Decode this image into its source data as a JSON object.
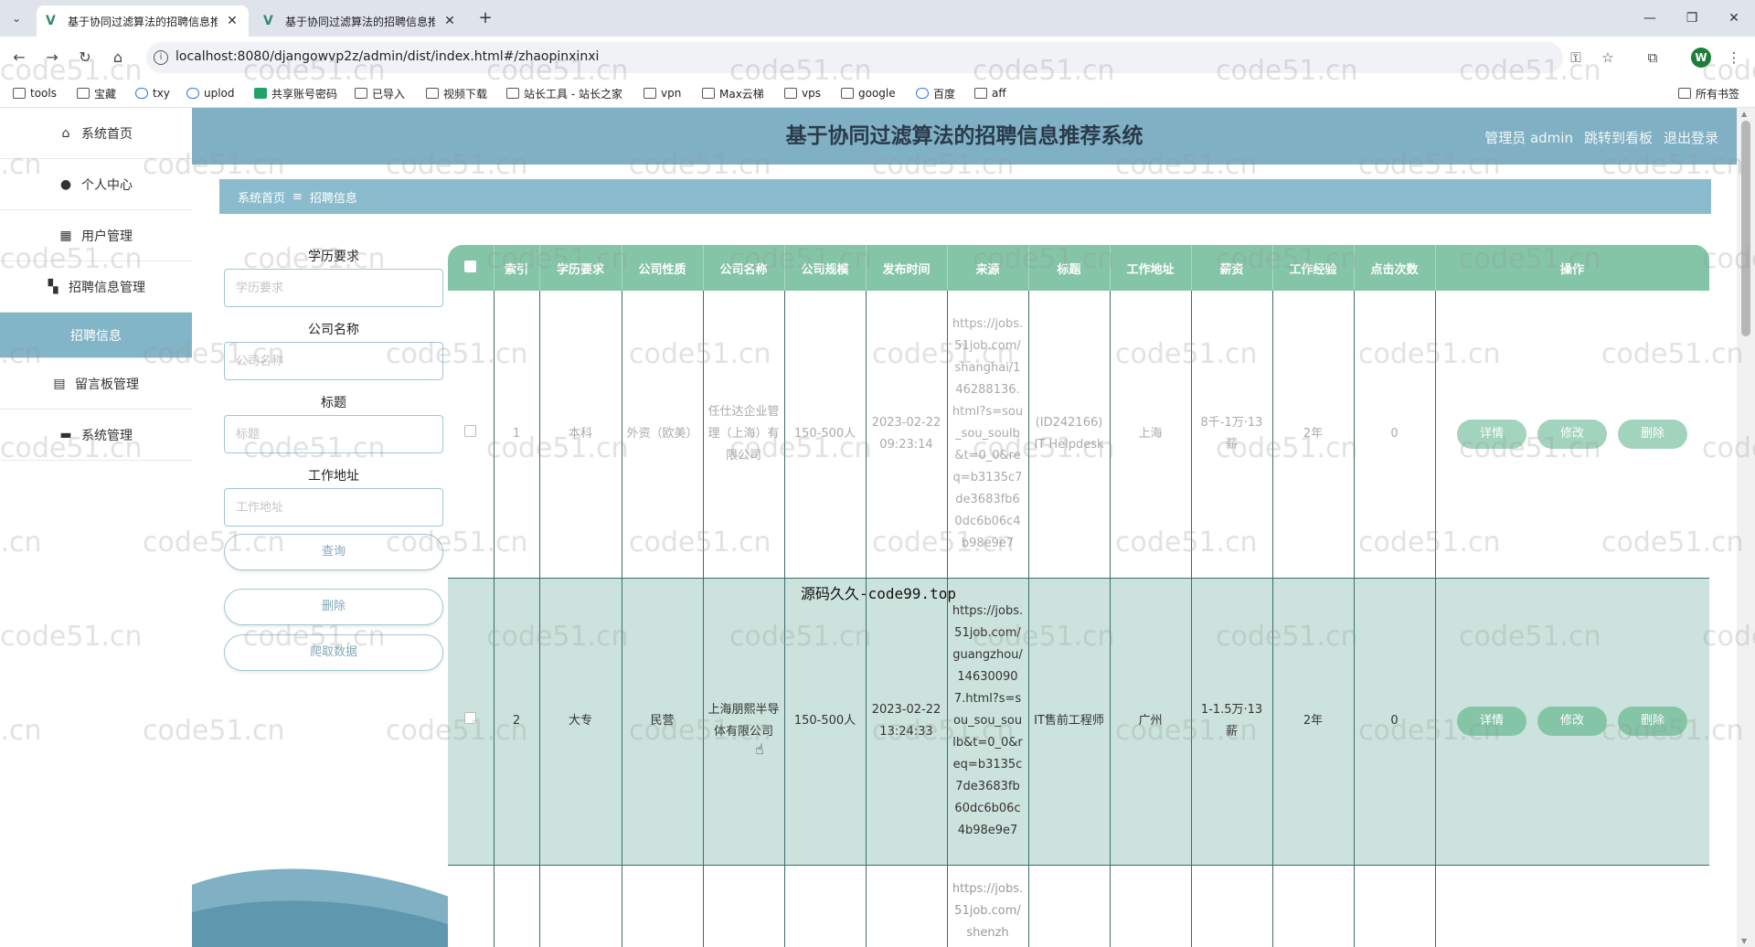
{
  "browser": {
    "tabs": [
      {
        "title": "基于协同过滤算法的招聘信息推",
        "active": true
      },
      {
        "title": "基于协同过滤算法的招聘信息推",
        "active": false
      }
    ],
    "url": "localhost:8080/djangowvp2z/admin/dist/index.html#/zhaopinxinxi",
    "avatar_letter": "W",
    "bookmarks": [
      "tools",
      "宝藏",
      "txy",
      "uplod",
      "共享账号密码",
      "已导入",
      "视频下载",
      "站长工具 - 站长之家",
      "vpn",
      "Max云梯",
      "vps",
      "google",
      "百度",
      "aff"
    ],
    "all_bookmarks": "所有书签"
  },
  "sidebar": {
    "items": [
      {
        "label": "系统首页",
        "icon": "home-icon"
      },
      {
        "label": "个人中心",
        "icon": "user-icon"
      },
      {
        "label": "用户管理",
        "icon": "grid-icon"
      },
      {
        "label": "招聘信息管理",
        "icon": "apps-icon"
      },
      {
        "label": "招聘信息",
        "icon": ""
      },
      {
        "label": "留言板管理",
        "icon": "message-icon"
      },
      {
        "label": "系统管理",
        "icon": "chat-icon"
      }
    ]
  },
  "header": {
    "title": "基于协同过滤算法的招聘信息推荐系统",
    "admin": "管理员 admin",
    "dashboard": "跳转到看板",
    "logout": "退出登录"
  },
  "breadcrumb": {
    "home": "系统首页",
    "sep": "≡",
    "current": "招聘信息"
  },
  "search": {
    "education_label": "学历要求",
    "education_placeholder": "学历要求",
    "company_label": "公司名称",
    "company_placeholder": "公司名称",
    "title_label": "标题",
    "title_placeholder": "标题",
    "address_label": "工作地址",
    "address_placeholder": "工作地址",
    "query_btn": "查询",
    "delete_btn": "删除",
    "crawl_btn": "爬取数据"
  },
  "table": {
    "headers": [
      "索引",
      "学历要求",
      "公司性质",
      "公司名称",
      "公司规模",
      "发布时间",
      "来源",
      "标题",
      "工作地址",
      "薪资",
      "工作经验",
      "点击次数",
      "操作"
    ],
    "rows": [
      {
        "index": "1",
        "education": "本科",
        "nature": "外资（欧美）",
        "company": "任仕达企业管理（上海）有限公司",
        "scale": "150-500人",
        "time": "2023-02-22 09:23:14",
        "source": "https://jobs.51job.com/shanghai/146288136.html?s=sou_sou_soulb&t=0_0&req=b3135c7de3683fb60dc6b06c4b98e9e7",
        "title": "(ID242166) IT Helpdesk",
        "address": "上海",
        "salary": "8千-1万·13薪",
        "experience": "2年",
        "clicks": "0"
      },
      {
        "index": "2",
        "education": "大专",
        "nature": "民营",
        "company": "上海朋熙半导体有限公司",
        "scale": "150-500人",
        "time": "2023-02-22 13:24:33",
        "source": "https://jobs.51job.com/guangzhou/146300907.html?s=sou_sou_soulb&t=0_0&req=b3135c7de3683fb60dc6b06c4b98e9e7",
        "title": "IT售前工程师",
        "address": "广州",
        "salary": "1-1.5万·13薪",
        "experience": "2年",
        "clicks": "0"
      },
      {
        "index": "",
        "education": "",
        "nature": "",
        "company": "",
        "scale": "",
        "time": "",
        "source": "https://jobs.51job.com/shenzh",
        "title": "",
        "address": "",
        "salary": "",
        "experience": "",
        "clicks": ""
      }
    ],
    "ops": {
      "detail": "详情",
      "edit": "修改",
      "delete": "删除"
    }
  },
  "overlay_text": "源码久久-code99.top",
  "watermark": "code51.cn",
  "colors": {
    "header": "#7fb0c3",
    "table_head": "#84c5a7",
    "selected_row": "#cbe3dc"
  }
}
